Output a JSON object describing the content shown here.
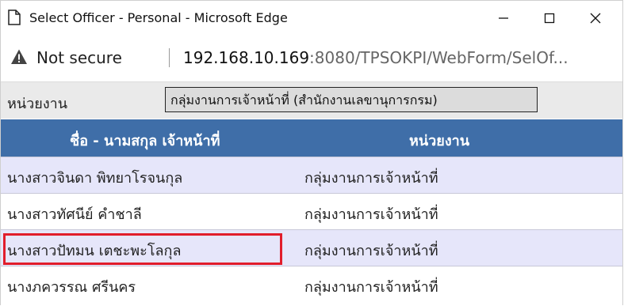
{
  "window": {
    "title": "Select Officer - Personal - Microsoft Edge",
    "minimize": "—",
    "maximize": "☐",
    "close": "✕"
  },
  "address": {
    "security": "Not secure",
    "url_host": "192.168.10.169",
    "url_rest": ":8080/TPSOKPI/WebForm/SelOf..."
  },
  "filter": {
    "label": "หน่วยงาน",
    "value": "กลุ่มงานการเจ้าหน้าที่ (สำนักงานเลขานุการกรม)"
  },
  "table": {
    "headers": {
      "name": "ชื่อ - นามสกุล เจ้าหน้าที่",
      "unit": "หน่วยงาน"
    },
    "rows": [
      {
        "name": "นางสาวจินดา พิทยาโรจนกุล",
        "unit": "กลุ่มงานการเจ้าหน้าที่"
      },
      {
        "name": "นางสาวทัศนีย์ คำชาลี",
        "unit": "กลุ่มงานการเจ้าหน้าที่"
      },
      {
        "name": "นางสาวปัทมน เตชะพะโลกุล",
        "unit": "กลุ่มงานการเจ้าหน้าที่"
      },
      {
        "name": "นางภควรรณ ศรีนคร",
        "unit": "กลุ่มงานการเจ้าหน้าที่"
      }
    ],
    "highlighted_row_index": 2
  },
  "colors": {
    "header_bg": "#3f6ea8",
    "row_alt_bg": "#e6e6fa",
    "highlight_border": "#e11d2b"
  }
}
